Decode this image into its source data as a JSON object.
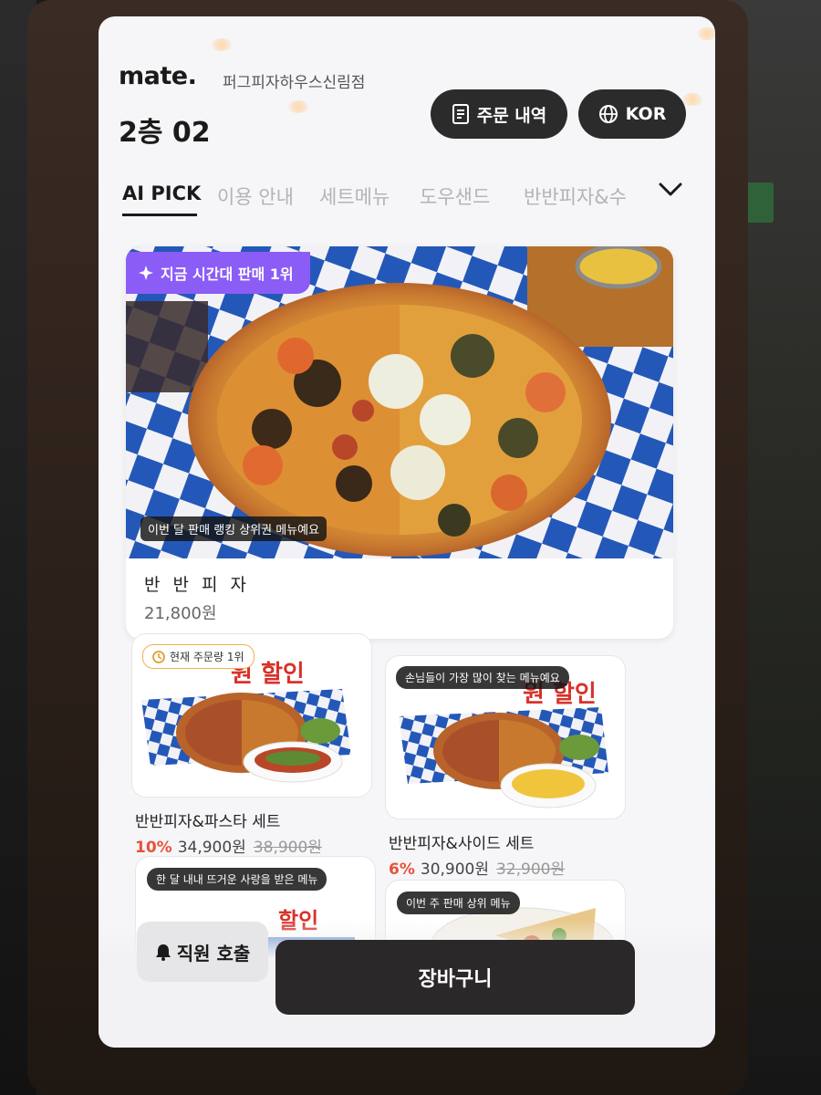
{
  "header": {
    "logo": "mate.",
    "store_name": "퍼그피자하우스신림점",
    "table_label": "2층 02",
    "orders_button": "주문 내역",
    "language_button": "KOR"
  },
  "tabs": [
    "AI PICK",
    "이용 안내",
    "세트메뉴",
    "도우샌드",
    "반반피자&수"
  ],
  "active_tab": "AI PICK",
  "featured": {
    "badge": "지금 시간대 판매 1위",
    "caption": "이번 달 판매 랭킹 상위권 메뉴예요",
    "name": "반 반 피 자",
    "price": "21,800원"
  },
  "menu_cards": [
    {
      "tag": "현재 주문량 1위",
      "promo_text": "원 할인",
      "name": "반반피자&파스타 세트",
      "discount": "10%",
      "price": "34,900원",
      "original_price": "38,900원"
    },
    {
      "tag": "손님들이 가장 많이 찾는 메뉴예요",
      "promo_text": "원 할인",
      "name": "반반피자&사이드 세트",
      "discount": "6%",
      "price": "30,900원",
      "original_price": "32,900원"
    }
  ],
  "partial_cards": [
    {
      "tag": "한 달 내내 뜨거운 사랑을 받은 메뉴",
      "promo_text": "할인"
    },
    {
      "tag": "이번 주 판매 상위 메뉴"
    }
  ],
  "footer": {
    "staff_call": "직원 호출",
    "cart": "장바구니"
  },
  "colors": {
    "accent_purple": "#8b5cf6",
    "discount_red": "#e5533a",
    "dark_button": "#2a2828"
  }
}
